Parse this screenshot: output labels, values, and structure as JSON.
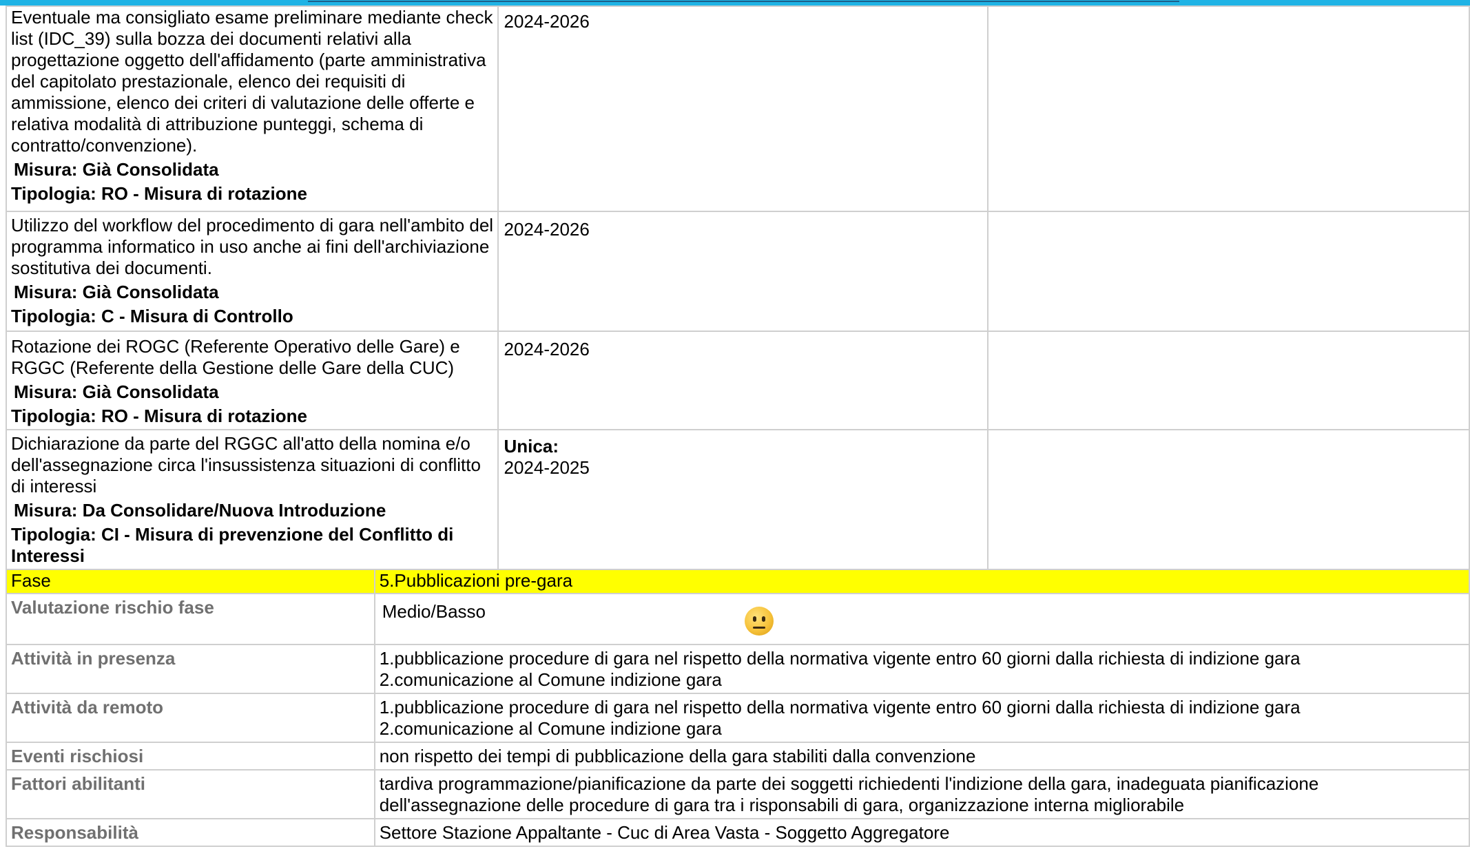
{
  "measures": [
    {
      "description": "Eventuale ma consigliato esame preliminare mediante check list (IDC_39) sulla bozza dei documenti relativi alla progettazione oggetto dell'affidamento (parte amministrativa del capitolato prestazionale, elenco dei requisiti di ammissione, elenco dei criteri di valutazione delle offerte e relativa modalità di attribuzione punteggi, schema di contratto/convenzione).",
      "misura": "Misura: Già Consolidata",
      "tipologia": "Tipologia: RO - Misura di rotazione",
      "period_label": "",
      "period": "2024-2026"
    },
    {
      "description": "Utilizzo del workflow del procedimento di gara nell'ambito del programma informatico in uso anche ai fini dell'archiviazione sostitutiva dei documenti.",
      "misura": "Misura: Già Consolidata",
      "tipologia": "Tipologia: C - Misura di Controllo",
      "period_label": "",
      "period": "2024-2026"
    },
    {
      "description": "Rotazione dei ROGC (Referente Operativo delle Gare) e RGGC (Referente della Gestione delle Gare della CUC)",
      "misura": "Misura: Già Consolidata",
      "tipologia": "Tipologia: RO - Misura di rotazione",
      "period_label": "",
      "period": "2024-2026"
    },
    {
      "description": "Dichiarazione da parte del RGGC all'atto della nomina e/o dell'assegnazione circa l'insussistenza situazioni di conflitto di interessi",
      "misura": "Misura: Da Consolidare/Nuova Introduzione",
      "tipologia": "Tipologia: CI - Misura di prevenzione del Conflitto di Interessi",
      "period_label": "Unica:",
      "period": "2024-2025"
    }
  ],
  "phase": {
    "fase_label": "Fase",
    "fase_value": "5.Pubblicazioni pre-gara",
    "valutazione_label": "Valutazione rischio fase",
    "valutazione_value": "Medio/Basso",
    "valutazione_icon": "neutral-face-icon",
    "presenza_label": "Attività in presenza",
    "presenza_line1": "1.pubblicazione procedure di gara nel rispetto della normativa vigente entro 60 giorni dalla richiesta di indizione gara",
    "presenza_line2": "2.comunicazione al Comune indizione gara",
    "remoto_label": "Attività da remoto",
    "remoto_line1": "1.pubblicazione procedure di gara nel rispetto della normativa vigente entro 60 giorni dalla richiesta di indizione gara",
    "remoto_line2": "2.comunicazione al Comune indizione gara",
    "eventi_label": "Eventi rischiosi",
    "eventi_value": "non rispetto dei tempi di pubblicazione della gara stabiliti dalla convenzione",
    "fattori_label": "Fattori abilitanti",
    "fattori_value": "tardiva programmazione/pianificazione da parte dei soggetti richiedenti l'indizione della gara, inadeguata pianificazione dell'assegnazione delle procedure di gara tra i risponsabili di gara, organizzazione interna migliorabile",
    "responsabilita_label": "Responsabilità",
    "responsabilita_value": "Settore Stazione Appaltante - Cuc di Area Vasta - Soggetto Aggregatore"
  },
  "colors": {
    "header_bar": "#1fb3e5",
    "fase_highlight": "#ffff00",
    "label_grey": "#707070",
    "border": "#cfcfcf"
  }
}
